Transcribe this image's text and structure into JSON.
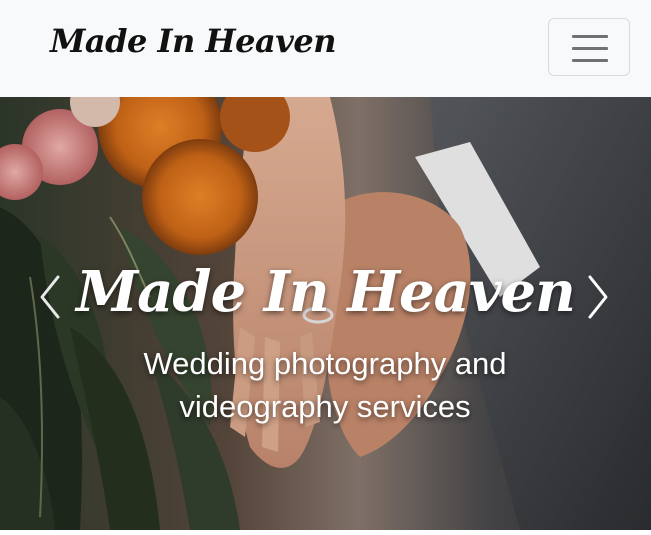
{
  "navbar": {
    "brand": "Made In Heaven",
    "toggler_icon": "hamburger-menu-icon"
  },
  "carousel": {
    "title": "Made In Heaven",
    "subtitle_line1": "Wedding photography and",
    "subtitle_line2": "videography services",
    "prev_icon": "chevron-left-icon",
    "next_icon": "chevron-right-icon"
  },
  "colors": {
    "navbar_bg": "#f8f9fa",
    "brand_text": "#111111",
    "caption_text": "#ffffff"
  }
}
